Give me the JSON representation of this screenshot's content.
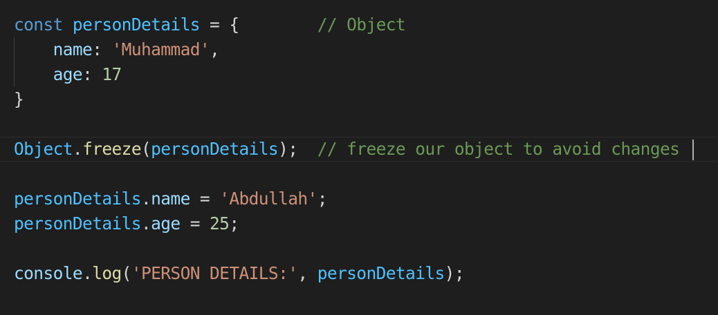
{
  "code": {
    "line1": {
      "keyword": "const",
      "name": "personDetails",
      "assign": " = {",
      "comment": "// Object"
    },
    "line2": {
      "key": "name",
      "colon": ": ",
      "value": "'Muhammad'",
      "comma": ","
    },
    "line3": {
      "key": "age",
      "colon": ": ",
      "value": "17"
    },
    "line4": {
      "brace": "}"
    },
    "line6": {
      "object": "Object",
      "dot": ".",
      "method": "freeze",
      "open": "(",
      "arg": "personDetails",
      "close": ");",
      "comment": "// freeze our object to avoid changes"
    },
    "line8": {
      "object": "personDetails",
      "dot": ".",
      "prop": "name",
      "assign": " = ",
      "value": "'Abdullah'",
      "end": ";"
    },
    "line9": {
      "object": "personDetails",
      "dot": ".",
      "prop": "age",
      "assign": " = ",
      "value": "25",
      "end": ";"
    },
    "line11": {
      "object": "console",
      "dot": ".",
      "method": "log",
      "open": "(",
      "arg1": "'PERSON DETAILS:'",
      "sep": ", ",
      "arg2": "personDetails",
      "close": ");"
    }
  },
  "colors": {
    "background": "#1e1e1e",
    "keyword": "#569cd6",
    "constant": "#4fc1ff",
    "property": "#9cdcfe",
    "function": "#dcdcaa",
    "string": "#ce9178",
    "number": "#b5cea8",
    "comment": "#6a9955",
    "plain": "#d4d4d4"
  }
}
